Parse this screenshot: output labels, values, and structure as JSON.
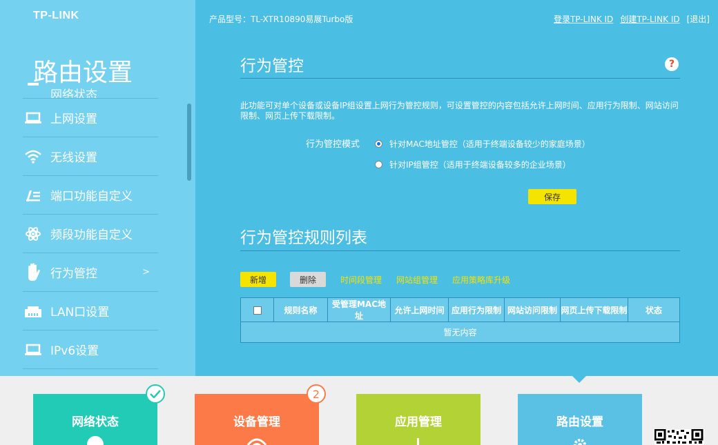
{
  "brand": {
    "logo": "TP-LINK"
  },
  "sidebar": {
    "title": "路由设置",
    "partial_item_label": "网络状态",
    "items": [
      {
        "label": "上网设置",
        "icon": "laptop-icon",
        "active": false
      },
      {
        "label": "无线设置",
        "icon": "wifi-icon",
        "active": false
      },
      {
        "label": "端口功能自定义",
        "icon": "port-config-icon",
        "active": false
      },
      {
        "label": "频段功能自定义",
        "icon": "atom-icon",
        "active": false
      },
      {
        "label": "行为管控",
        "icon": "hand-icon",
        "active": true,
        "arrow": ">"
      },
      {
        "label": "LAN口设置",
        "icon": "lan-port-icon",
        "active": false
      },
      {
        "label": "IPv6设置",
        "icon": "laptop-icon",
        "active": false
      }
    ]
  },
  "header": {
    "model": "产品型号：TL-XTR10890易展Turbo版",
    "login": "登录TP-LINK ID",
    "create": "创建TP-LINK ID",
    "logout": "[退出]"
  },
  "section1": {
    "title": "行为管控",
    "help": "?",
    "description": "此功能可对单个设备或设备IP组设置上网行为管控规则，可设置管控的内容包括允许上网时间、应用行为限制、网站访问限制、网页上传下载限制。",
    "mode_label": "行为管控模式",
    "option_mac": "针对MAC地址管控（适用于终端设备较少的家庭场景）",
    "option_ip": "针对IP组管控（适用于终端设备较多的企业场景）",
    "selected": "mac",
    "save": "保存"
  },
  "section2": {
    "title": "行为管控规则列表",
    "add": "新增",
    "delete": "删除",
    "links": [
      "时间段管理",
      "网站组管理",
      "应用策略库升级"
    ],
    "columns": [
      "规则名称",
      "受管理MAC地址",
      "允许上网时间",
      "应用行为限制",
      "网站访问限制",
      "网页上传下载限制",
      "状态"
    ],
    "empty": "暂无内容"
  },
  "tiles": [
    {
      "label": "网络状态",
      "color": "#22cbb6",
      "badge": "check"
    },
    {
      "label": "设备管理",
      "color": "#fb7a48",
      "badge": "2"
    },
    {
      "label": "应用管理",
      "color": "#b2d236"
    },
    {
      "label": "路由设置",
      "color": "#5ac1e4"
    }
  ],
  "colors": {
    "sidebar": "#74d1ef",
    "main": "#4bbee3",
    "accent_yellow": "#f5e300"
  }
}
